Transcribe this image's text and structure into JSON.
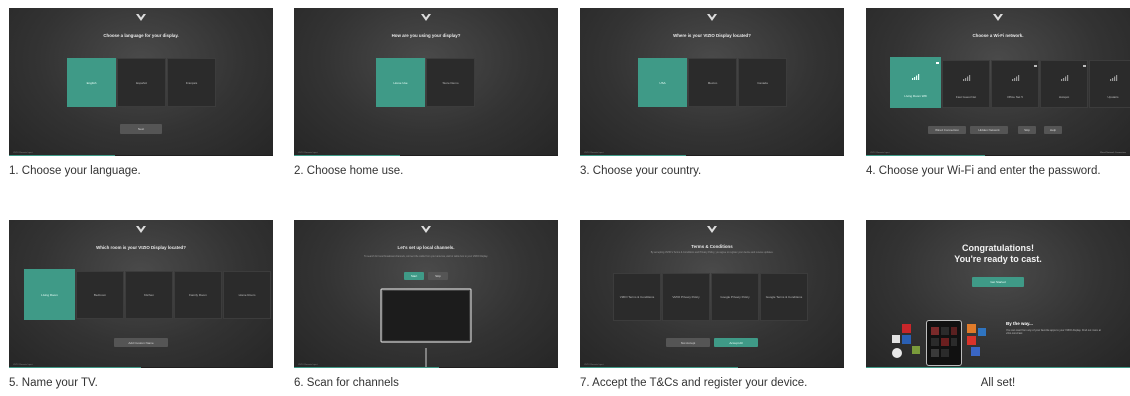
{
  "colors": {
    "accent": "#3f9a87",
    "screen_bg": "#333333",
    "caption_text": "#333333"
  },
  "panels": [
    {
      "caption": "1.  Choose your language.",
      "screen": {
        "title": "Choose a language for your display.",
        "options": [
          "English",
          "Español",
          "Français"
        ],
        "button": "Next",
        "footer": "VIZIO Remote Input",
        "progress": 0.4
      }
    },
    {
      "caption": "2.  Choose home use.",
      "screen": {
        "title": "How are you using your display?",
        "options": [
          "Home Use",
          "Store Demo"
        ],
        "footer": "VIZIO Remote Input",
        "progress": 0.4
      }
    },
    {
      "caption": "3.  Choose your country.",
      "screen": {
        "title": "Where is your VIZIO Display located?",
        "options": [
          "USA",
          "Mexico",
          "Canada"
        ],
        "footer": "VIZIO Remote Input",
        "progress": 0.4
      }
    },
    {
      "caption": "4.  Choose your Wi-Fi and enter the password.",
      "screen": {
        "title": "Choose a Wi-Fi network.",
        "networks": [
          "Living Room Wifi",
          "Fast Guest Net",
          "Office Net 5",
          "Hotspot",
          "Upstairs"
        ],
        "buttons": [
          "Wired Connection",
          "Hidden Network",
          "Skip",
          "Help"
        ],
        "footer": "VIZIO Remote Input",
        "footer_right": "Wired Network Connection",
        "progress": 0.45
      }
    },
    {
      "caption": "5.  Name your TV.",
      "screen": {
        "title": "Which room is your VIZIO Display located?",
        "options": [
          "Living Room",
          "Bedroom",
          "Kitchen",
          "Family Room",
          "Home Room"
        ],
        "button": "Add Custom Name",
        "footer": "VIZIO Remote Input",
        "progress": 0.5
      }
    },
    {
      "caption": "6.  Scan for channels",
      "screen": {
        "title": "Let's set up local channels.",
        "subtitle": "To search for local broadcast channels, connect the cable from your antenna, wall or cable box to your VIZIO Display.",
        "buttons": [
          "Start",
          "Skip"
        ],
        "footer": "VIZIO Remote Input",
        "progress": 0.55
      }
    },
    {
      "caption": "7.  Accept the T&Cs and register your device.",
      "screen": {
        "title": "Terms & Conditions",
        "subtitle": "By accepting VIZIO's Terms & Conditions and Privacy Policy, you agree to register your device and receive updates.",
        "options": [
          "VIZIO Terms & Conditions",
          "VIZIO Privacy Policy",
          "Google Privacy Policy",
          "Google Terms & Conditions"
        ],
        "buttons": [
          "Not Accept",
          "Accept All"
        ],
        "footer": "VIZIO Remote Input",
        "progress": 0.6
      }
    },
    {
      "caption": "All set!",
      "screen": {
        "title": "Congratulations!",
        "title2": "You're ready to cast.",
        "button": "Get Started",
        "by_the_way": "By the way...",
        "promo_text": "You can cast from any of your favorite apps to your VIZIO display. Find out more at vizio.com/cast",
        "progress": 1.0
      }
    }
  ]
}
